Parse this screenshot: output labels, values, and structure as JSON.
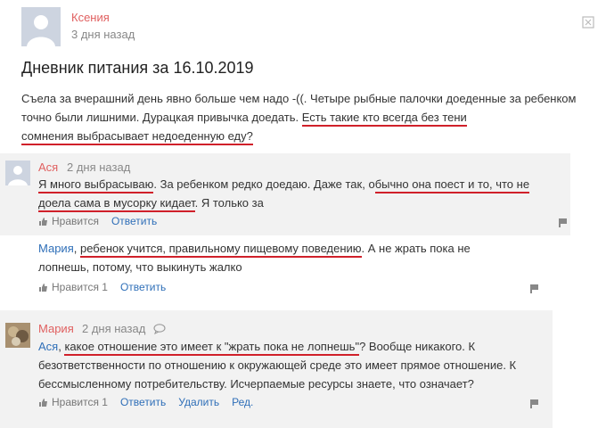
{
  "post": {
    "author": "Ксения",
    "date": "3 дня назад",
    "title": "Дневник питания за 16.10.2019",
    "line1": "Съела за вчерашний день явно больше чем надо -((. Четыре рыбные палочки доеденные за ребенком",
    "line2a": "точно были лишними. Дурацкая привычка доедать. ",
    "line2b": "Есть такие кто всегда без тени",
    "line3": "сомнения выбрасывает недоеденную еду?"
  },
  "comment1": {
    "author": "Ася",
    "date": "2 дня назад",
    "l1a": "Я много выбрасываю",
    "l1b": ". За ребенком редко доедаю. Даже так, о",
    "l1c": "бычно она поест и то, что не",
    "l2a": "доела сама в мусорку кидает",
    "l2b": ". Я только за",
    "like": "Нравится",
    "reply": "Ответить"
  },
  "comment2": {
    "mention": "Мария",
    "l1a": ", ",
    "l1b": "ребенок учится, правильному пищевому поведению",
    "l1c": ". А не жрать пока не",
    "l2": "лопнешь, потому, что выкинуть жалко",
    "like": "Нравится 1",
    "reply": "Ответить"
  },
  "comment3": {
    "author": "Мария",
    "date": "2 дня назад",
    "mention": "Ася",
    "l1a": ", ",
    "l1b": "какое отношение это имеет к \"жрать пока не лопнешь\"",
    "l1c": "? Вообще никакого. К",
    "l2": "безответственности по отношению к окружающей среде это имеет прямое отношение. К",
    "l3": "бессмысленному потребительству. Исчерпаемые ресурсы знаете, что означает?",
    "like": "Нравится 1",
    "reply": "Ответить",
    "delete": "Удалить",
    "edit": "Ред."
  },
  "colors": {
    "accent_red": "#d0202a",
    "link": "#2f6fb8",
    "author": "#e06060"
  }
}
